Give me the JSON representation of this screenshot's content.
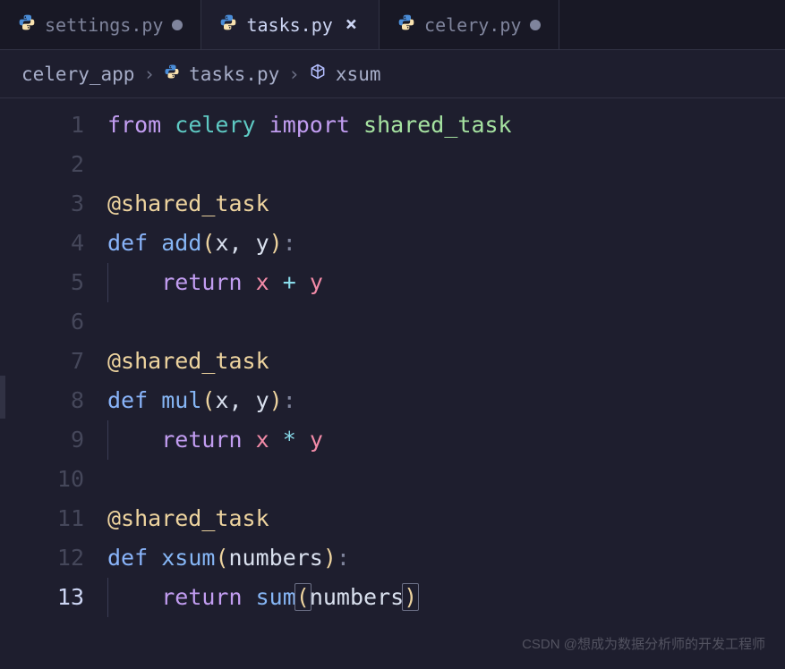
{
  "tabs": [
    {
      "label": "settings.py",
      "modified": true,
      "active": false
    },
    {
      "label": "tasks.py",
      "modified": false,
      "active": true
    },
    {
      "label": "celery.py",
      "modified": true,
      "active": false
    }
  ],
  "breadcrumb": {
    "folder": "celery_app",
    "file": "tasks.py",
    "symbol": "xsum"
  },
  "code": {
    "line1": {
      "from": "from",
      "module": "celery",
      "import": "import",
      "name": "shared_task"
    },
    "line3": {
      "decorator": "@shared_task"
    },
    "line4": {
      "def": "def",
      "func": "add",
      "params": "x, y"
    },
    "line5": {
      "return": "return",
      "expr_a": "x",
      "op": "+",
      "expr_b": "y"
    },
    "line7": {
      "decorator": "@shared_task"
    },
    "line8": {
      "def": "def",
      "func": "mul",
      "params": "x, y"
    },
    "line9": {
      "return": "return",
      "expr_a": "x",
      "op": "*",
      "expr_b": "y"
    },
    "line11": {
      "decorator": "@shared_task"
    },
    "line12": {
      "def": "def",
      "func": "xsum",
      "params": "numbers"
    },
    "line13": {
      "return": "return",
      "call": "sum",
      "arg": "numbers"
    }
  },
  "line_numbers": [
    "1",
    "2",
    "3",
    "4",
    "5",
    "6",
    "7",
    "8",
    "9",
    "10",
    "11",
    "12",
    "13"
  ],
  "watermark": "CSDN @想成为数据分析师的开发工程师"
}
